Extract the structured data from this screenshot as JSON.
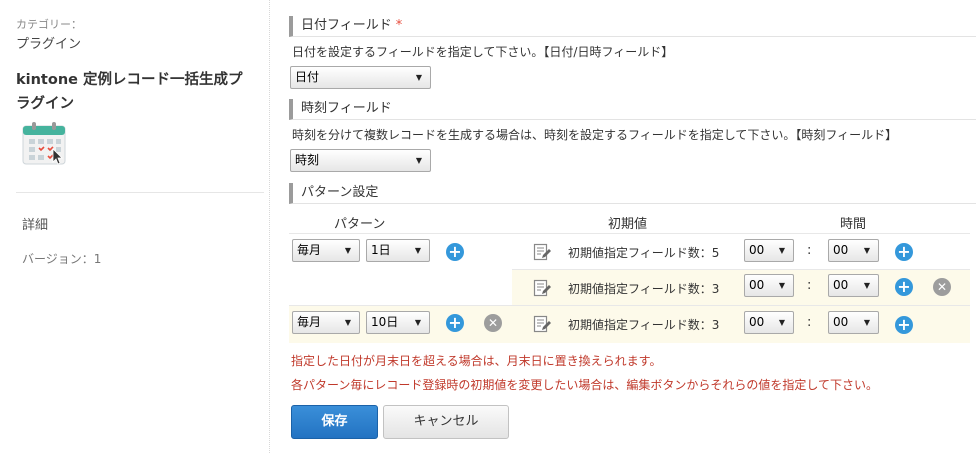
{
  "sidebar": {
    "category_label": "カテゴリー：",
    "category_value": "プラグイン",
    "plugin_name": "kintone 定例レコード一括生成プラグイン",
    "detail_label": "詳細",
    "version_label": "バージョン：1"
  },
  "date_section": {
    "title": "日付フィールド",
    "required_mark": "*",
    "description": "日付を設定するフィールドを指定して下さい。【日付/日時フィールド】",
    "selected": "日付"
  },
  "time_section": {
    "title": "時刻フィールド",
    "description": "時刻を分けて複数レコードを生成する場合は、時刻を設定するフィールドを指定して下さい。【時刻フィールド】",
    "selected": "時刻"
  },
  "pattern_section": {
    "title": "パターン設定",
    "headers": {
      "pattern": "パターン",
      "initial": "初期値",
      "time": "時間"
    },
    "time_separator": ":",
    "rows": [
      {
        "freq": "毎月",
        "day": "1日",
        "initial_text": "初期値指定フィールド数：5",
        "hour": "00",
        "minute": "00"
      },
      {
        "initial_text": "初期値指定フィールド数：3",
        "hour": "00",
        "minute": "00"
      },
      {
        "freq": "毎月",
        "day": "10日",
        "initial_text": "初期値指定フィールド数：3",
        "hour": "00",
        "minute": "00"
      }
    ]
  },
  "notes": [
    "指定した日付が月末日を超える場合は、月末日に置き換えられます。",
    "各パターン毎にレコード登録時の初期値を変更したい場合は、編集ボタンからそれらの値を指定して下さい。"
  ],
  "buttons": {
    "save": "保存",
    "cancel": "キャンセル"
  },
  "icons": {
    "add": "plus-circle-icon",
    "remove": "close-circle-icon",
    "edit": "edit-note-icon",
    "dropdown": "triangle-down-icon"
  },
  "colors": {
    "accent": "#3498db",
    "note": "#c0392b",
    "required": "#e74c3c",
    "row_highlight": "#fdfaea"
  }
}
